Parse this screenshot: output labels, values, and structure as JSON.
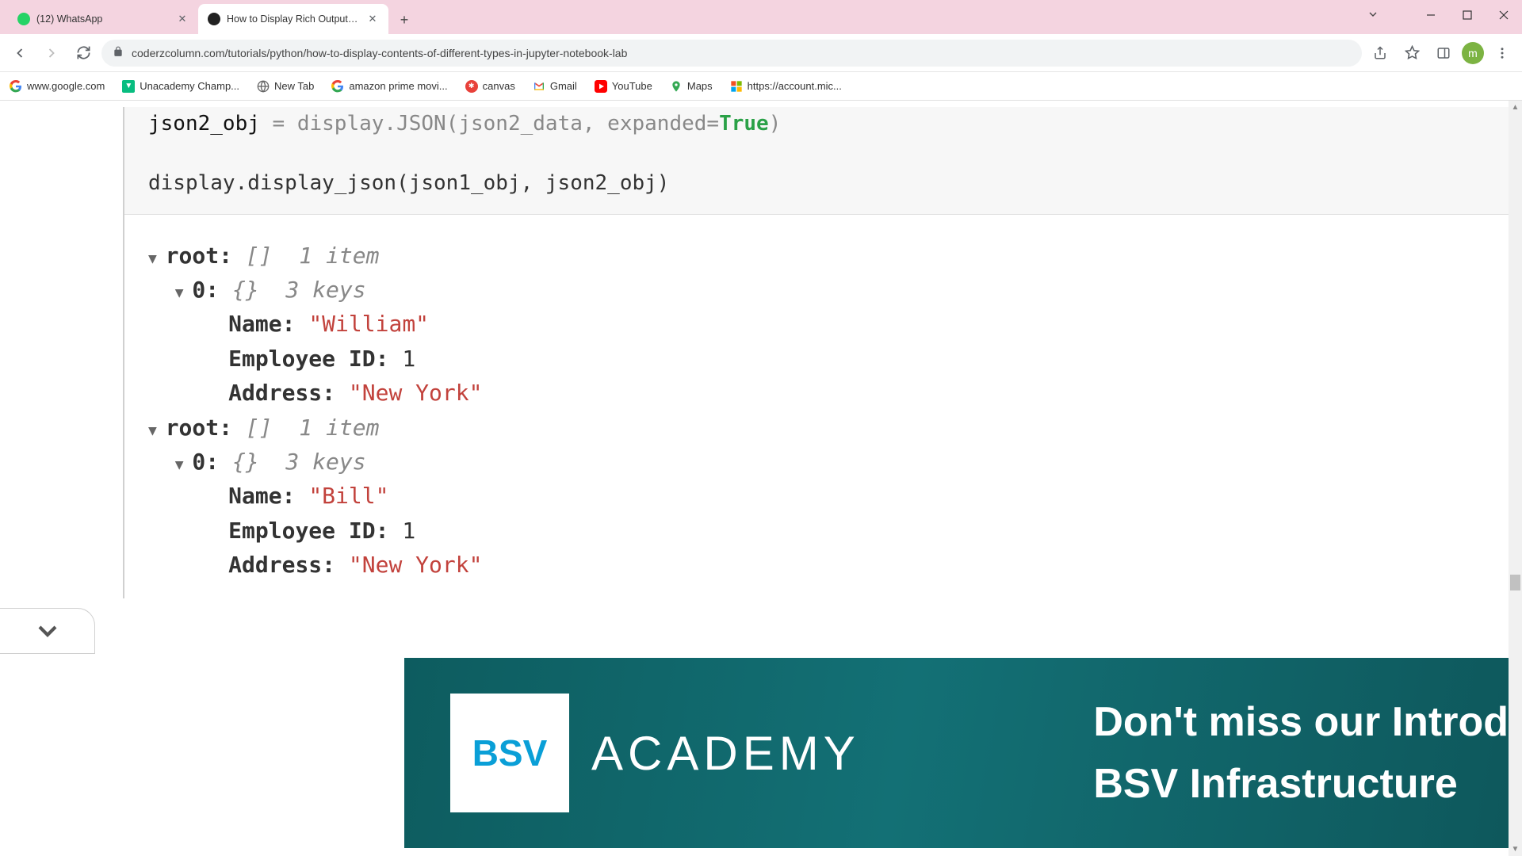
{
  "tabs": [
    {
      "title": "(12) WhatsApp",
      "active": false
    },
    {
      "title": "How to Display Rich Outputs (im",
      "active": true
    }
  ],
  "url": "coderzcolumn.com/tutorials/python/how-to-display-contents-of-different-types-in-jupyter-notebook-lab",
  "avatar_letter": "m",
  "bookmarks": [
    {
      "label": "www.google.com"
    },
    {
      "label": "Unacademy Champ..."
    },
    {
      "label": "New Tab"
    },
    {
      "label": "amazon prime movi..."
    },
    {
      "label": "canvas"
    },
    {
      "label": "Gmail"
    },
    {
      "label": "YouTube"
    },
    {
      "label": "Maps"
    },
    {
      "label": "https://account.mic..."
    }
  ],
  "code": {
    "cut_line": "json2_obj = display.JSON(json2_data, expanded=True)",
    "line2": "display.display_json(json1_obj, json2_obj)"
  },
  "json_trees": [
    {
      "root_label": "root:",
      "root_bracket": "[]",
      "root_meta": "1 item",
      "items": [
        {
          "idx_label": "0:",
          "idx_bracket": "{}",
          "idx_meta": "3 keys",
          "pairs": [
            {
              "k": "Name:",
              "v": "\"William\"",
              "type": "string"
            },
            {
              "k": "Employee ID:",
              "v": "1",
              "type": "number"
            },
            {
              "k": "Address:",
              "v": "\"New York\"",
              "type": "string"
            }
          ]
        }
      ]
    },
    {
      "root_label": "root:",
      "root_bracket": "[]",
      "root_meta": "1 item",
      "items": [
        {
          "idx_label": "0:",
          "idx_bracket": "{}",
          "idx_meta": "3 keys",
          "pairs": [
            {
              "k": "Name:",
              "v": "\"Bill\"",
              "type": "string"
            },
            {
              "k": "Employee ID:",
              "v": "1",
              "type": "number"
            },
            {
              "k": "Address:",
              "v": "\"New York\"",
              "type": "string"
            }
          ]
        }
      ]
    }
  ],
  "ad": {
    "logo": "BSV",
    "academy": "ACADEMY",
    "line1": "Don't miss our Introd",
    "line2": "BSV Infrastructure"
  }
}
